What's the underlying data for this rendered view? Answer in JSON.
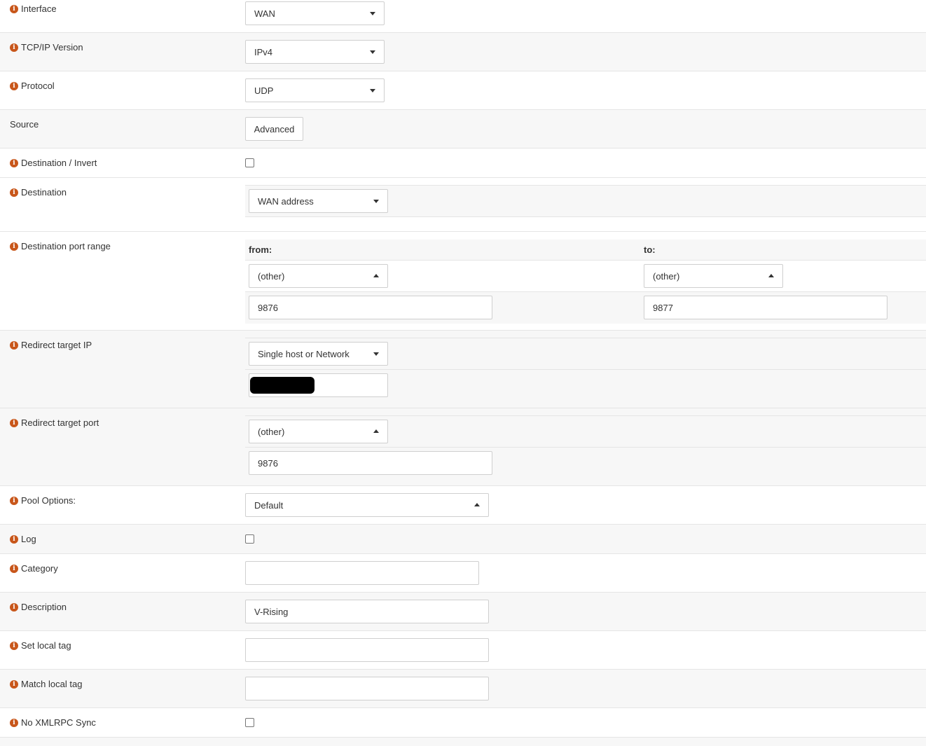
{
  "fields": {
    "interface": {
      "label": "Interface",
      "value": "WAN"
    },
    "tcpip_version": {
      "label": "TCP/IP Version",
      "value": "IPv4"
    },
    "protocol": {
      "label": "Protocol",
      "value": "UDP"
    },
    "source": {
      "label": "Source",
      "button": "Advanced"
    },
    "destination_invert": {
      "label": "Destination / Invert",
      "checked": false
    },
    "destination": {
      "label": "Destination",
      "value": "WAN address"
    },
    "destination_port_range": {
      "label": "Destination port range",
      "from_label": "from:",
      "to_label": "to:",
      "from_select": "(other)",
      "to_select": "(other)",
      "from_value": "9876",
      "to_value": "9877"
    },
    "redirect_target_ip": {
      "label": "Redirect target IP",
      "value": "Single host or Network",
      "input": ""
    },
    "redirect_target_port": {
      "label": "Redirect target port",
      "select": "(other)",
      "value": "9876"
    },
    "pool_options": {
      "label": "Pool Options:",
      "value": "Default"
    },
    "log": {
      "label": "Log",
      "checked": false
    },
    "category": {
      "label": "Category",
      "value": ""
    },
    "description": {
      "label": "Description",
      "value": "V-Rising"
    },
    "set_local_tag": {
      "label": "Set local tag",
      "value": ""
    },
    "match_local_tag": {
      "label": "Match local tag",
      "value": ""
    },
    "no_xmlrpc_sync": {
      "label": "No XMLRPC Sync",
      "checked": false
    }
  },
  "colors": {
    "info_icon": "#c8561a",
    "row_alt": "#f7f7f7",
    "border": "#cfcfcf"
  }
}
